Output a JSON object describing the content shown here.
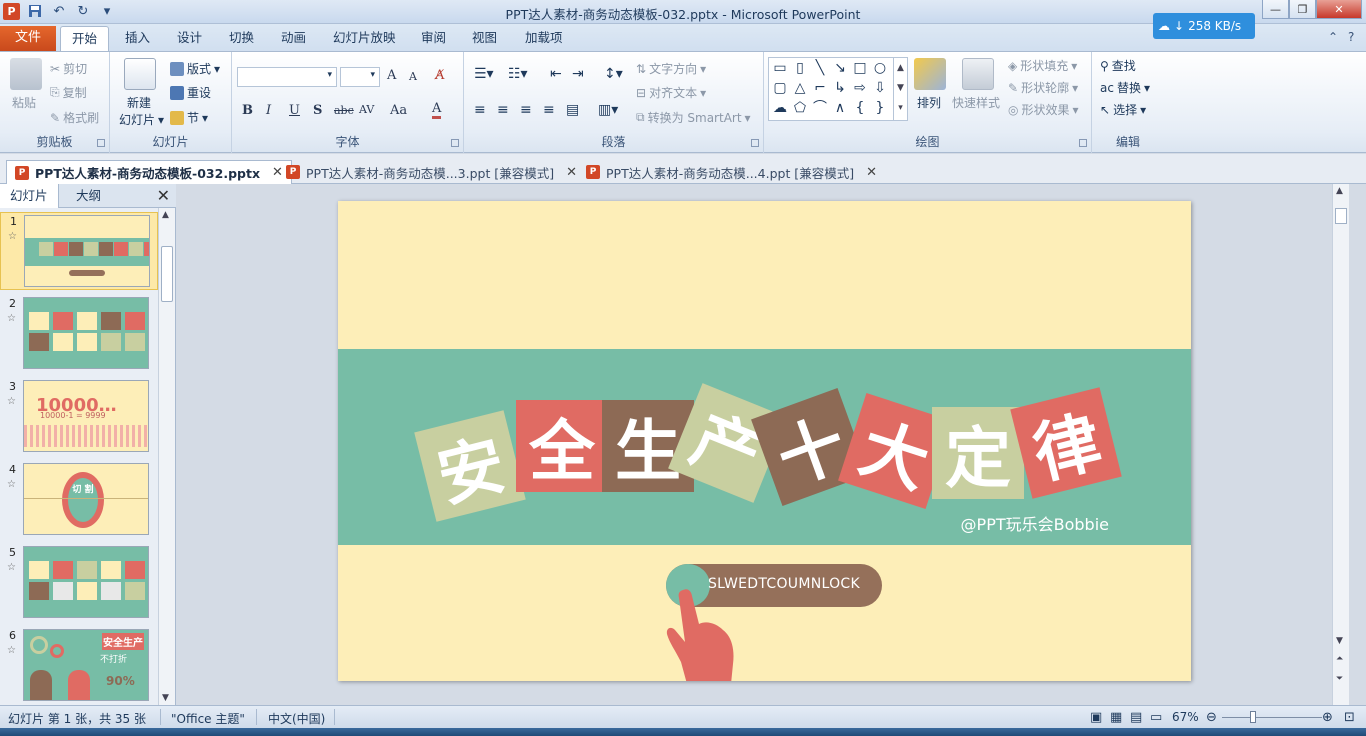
{
  "title_bar": {
    "app_logo": "P",
    "title": "PPT达人素材-商务动态模板-032.pptx - Microsoft PowerPoint",
    "net_speed": "258 KB/s"
  },
  "ribbon_tabs": [
    "文件",
    "开始",
    "插入",
    "设计",
    "切换",
    "动画",
    "幻灯片放映",
    "审阅",
    "视图",
    "加载项"
  ],
  "ribbon": {
    "clipboard": {
      "label": "剪贴板",
      "paste": "粘贴",
      "cut": "剪切",
      "copy": "复制",
      "format_painter": "格式刷"
    },
    "slides": {
      "label": "幻灯片",
      "new_slide_1": "新建",
      "new_slide_2": "幻灯片",
      "layout": "版式",
      "reset": "重设",
      "section": "节"
    },
    "font": {
      "label": "字体",
      "grow": "A",
      "shrink": "A",
      "bold": "B",
      "italic": "I",
      "underline": "U",
      "shadow": "S",
      "strike": "abc",
      "spacing": "AV",
      "case": "Aa",
      "color": "A"
    },
    "paragraph": {
      "label": "段落",
      "text_direction": "文字方向",
      "align_text": "对齐文本",
      "smartart": "转换为 SmartArt"
    },
    "drawing": {
      "label": "绘图",
      "arrange": "排列",
      "quick_styles": "快速样式",
      "shape_fill": "形状填充",
      "shape_outline": "形状轮廓",
      "shape_effects": "形状效果"
    },
    "editing": {
      "label": "编辑",
      "find": "查找",
      "replace": "替换",
      "select": "选择"
    }
  },
  "doc_tabs": [
    {
      "label": "PPT达人素材-商务动态模板-032.pptx",
      "active": true
    },
    {
      "label": "PPT达人素材-商务动态模...3.ppt [兼容模式]",
      "active": false
    },
    {
      "label": "PPT达人素材-商务动态模...4.ppt [兼容模式]",
      "active": false
    }
  ],
  "left_pane": {
    "tabs": [
      "幻灯片",
      "大纲"
    ],
    "slides": [
      {
        "num": "1",
        "star": "☆"
      },
      {
        "num": "2",
        "star": "☆"
      },
      {
        "num": "3",
        "star": "☆",
        "text": "10000…",
        "sub": "10000-1 = 9999"
      },
      {
        "num": "4",
        "star": "☆",
        "text": "切 割"
      },
      {
        "num": "5",
        "star": "☆"
      },
      {
        "num": "6",
        "star": "☆",
        "text": "安全生产",
        "sub": "不打折",
        "extra": "90%"
      }
    ]
  },
  "slide": {
    "title_chars": [
      "安",
      "全",
      "生",
      "产",
      "十",
      "大",
      "定",
      "律"
    ],
    "credit": "@PPT玩乐会Bobbie",
    "slider_text": "SLWEDTCOUMNLOCK"
  },
  "status_bar": {
    "slide_info": "幻灯片 第 1 张，共 35 张",
    "theme": "\"Office 主题\"",
    "language": "中文(中国)",
    "zoom": "67%"
  },
  "colors": {
    "slide_bg": "#fdeeb8",
    "band": "#77bda6",
    "tile_green": "#c8cfa0",
    "tile_red": "#e06b63",
    "tile_brown": "#8d6a55",
    "file_tab": "#d9582a"
  }
}
